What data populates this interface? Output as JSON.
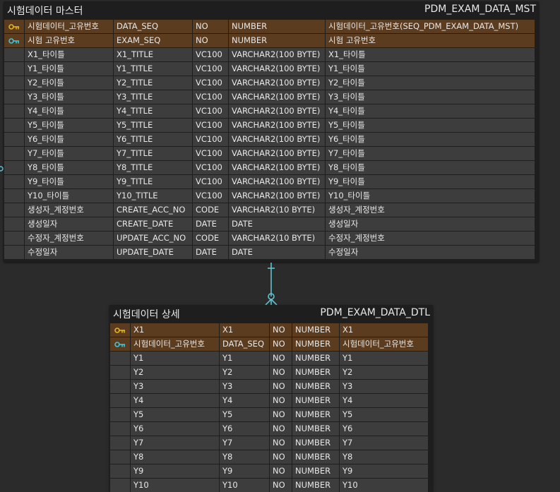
{
  "master": {
    "logical_name": "시험데이터 마스터",
    "physical_name": "PDM_EXAM_DATA_MST",
    "columns": [
      {
        "key": "pk",
        "logical": "시험데이터_고유번호",
        "physical": "DATA_SEQ",
        "domain": "NO",
        "type": "NUMBER",
        "comment": "시험데이터_고유번호(SEQ_PDM_EXAM_DATA_MST)"
      },
      {
        "key": "pkfk",
        "logical": "시험 고유번호",
        "physical": "EXAM_SEQ",
        "domain": "NO",
        "type": "NUMBER",
        "comment": "시험 고유번호"
      },
      {
        "key": "",
        "logical": "X1_타이틀",
        "physical": "X1_TITLE",
        "domain": "VC100",
        "type": "VARCHAR2(100 BYTE)",
        "comment": "X1_타이틀"
      },
      {
        "key": "",
        "logical": "Y1_타이틀",
        "physical": "Y1_TITLE",
        "domain": "VC100",
        "type": "VARCHAR2(100 BYTE)",
        "comment": "Y1_타이틀"
      },
      {
        "key": "",
        "logical": "Y2_타이틀",
        "physical": "Y2_TITLE",
        "domain": "VC100",
        "type": "VARCHAR2(100 BYTE)",
        "comment": "Y2_타이틀"
      },
      {
        "key": "",
        "logical": "Y3_타이틀",
        "physical": "Y3_TITLE",
        "domain": "VC100",
        "type": "VARCHAR2(100 BYTE)",
        "comment": "Y3_타이틀"
      },
      {
        "key": "",
        "logical": "Y4_타이틀",
        "physical": "Y4_TITLE",
        "domain": "VC100",
        "type": "VARCHAR2(100 BYTE)",
        "comment": "Y4_타이틀"
      },
      {
        "key": "",
        "logical": "Y5_타이틀",
        "physical": "Y5_TITLE",
        "domain": "VC100",
        "type": "VARCHAR2(100 BYTE)",
        "comment": "Y5_타이틀"
      },
      {
        "key": "",
        "logical": "Y6_타이틀",
        "physical": "Y6_TITLE",
        "domain": "VC100",
        "type": "VARCHAR2(100 BYTE)",
        "comment": "Y6_타이틀"
      },
      {
        "key": "",
        "logical": "Y7_타이틀",
        "physical": "Y7_TITLE",
        "domain": "VC100",
        "type": "VARCHAR2(100 BYTE)",
        "comment": "Y7_타이틀"
      },
      {
        "key": "",
        "logical": "Y8_타이틀",
        "physical": "Y8_TITLE",
        "domain": "VC100",
        "type": "VARCHAR2(100 BYTE)",
        "comment": "Y8_타이틀"
      },
      {
        "key": "",
        "logical": "Y9_타이틀",
        "physical": "Y9_TITLE",
        "domain": "VC100",
        "type": "VARCHAR2(100 BYTE)",
        "comment": "Y9_타이틀"
      },
      {
        "key": "",
        "logical": "Y10_타이틀",
        "physical": "Y10_TITLE",
        "domain": "VC100",
        "type": "VARCHAR2(100 BYTE)",
        "comment": "Y10_타이틀"
      },
      {
        "key": "",
        "logical": "생성자_계정번호",
        "physical": "CREATE_ACC_NO",
        "domain": "CODE",
        "type": "VARCHAR2(10 BYTE)",
        "comment": "생성자_계정번호"
      },
      {
        "key": "",
        "logical": "생성일자",
        "physical": "CREATE_DATE",
        "domain": "DATE",
        "type": "DATE",
        "comment": "생성일자"
      },
      {
        "key": "",
        "logical": "수정자_계정번호",
        "physical": "UPDATE_ACC_NO",
        "domain": "CODE",
        "type": "VARCHAR2(10 BYTE)",
        "comment": "수정자_계정번호"
      },
      {
        "key": "",
        "logical": "수정일자",
        "physical": "UPDATE_DATE",
        "domain": "DATE",
        "type": "DATE",
        "comment": "수정일자"
      }
    ]
  },
  "detail": {
    "logical_name": "시험데이터 상세",
    "physical_name": "PDM_EXAM_DATA_DTL",
    "columns": [
      {
        "key": "pk",
        "logical": "X1",
        "physical": "X1",
        "domain": "NO",
        "type": "NUMBER",
        "comment": "X1"
      },
      {
        "key": "pkfk",
        "logical": "시험데이터_고유번호",
        "physical": "DATA_SEQ",
        "domain": "NO",
        "type": "NUMBER",
        "comment": "시험데이터_고유번호"
      },
      {
        "key": "",
        "logical": "Y1",
        "physical": "Y1",
        "domain": "NO",
        "type": "NUMBER",
        "comment": "Y1"
      },
      {
        "key": "",
        "logical": "Y2",
        "physical": "Y2",
        "domain": "NO",
        "type": "NUMBER",
        "comment": "Y2"
      },
      {
        "key": "",
        "logical": "Y3",
        "physical": "Y3",
        "domain": "NO",
        "type": "NUMBER",
        "comment": "Y3"
      },
      {
        "key": "",
        "logical": "Y4",
        "physical": "Y4",
        "domain": "NO",
        "type": "NUMBER",
        "comment": "Y4"
      },
      {
        "key": "",
        "logical": "Y5",
        "physical": "Y5",
        "domain": "NO",
        "type": "NUMBER",
        "comment": "Y5"
      },
      {
        "key": "",
        "logical": "Y6",
        "physical": "Y6",
        "domain": "NO",
        "type": "NUMBER",
        "comment": "Y6"
      },
      {
        "key": "",
        "logical": "Y7",
        "physical": "Y7",
        "domain": "NO",
        "type": "NUMBER",
        "comment": "Y7"
      },
      {
        "key": "",
        "logical": "Y8",
        "physical": "Y8",
        "domain": "NO",
        "type": "NUMBER",
        "comment": "Y8"
      },
      {
        "key": "",
        "logical": "Y9",
        "physical": "Y9",
        "domain": "NO",
        "type": "NUMBER",
        "comment": "Y9"
      },
      {
        "key": "",
        "logical": "Y10",
        "physical": "Y10",
        "domain": "NO",
        "type": "NUMBER",
        "comment": "Y10"
      }
    ]
  },
  "relationship": {
    "from": "PDM_EXAM_DATA_MST",
    "to": "PDM_EXAM_DATA_DTL",
    "cardinality": "one-to-many",
    "icon": "crowfoot-connector"
  },
  "colors": {
    "pk_row": "#5b3c1e",
    "cell": "#3d3d3d",
    "entity_bg": "#1e1e1e",
    "canvas": "#2b2b2b",
    "pk_key": "#e6b422",
    "fk_key": "#3fc6d8",
    "connector": "#5fc4d0"
  }
}
